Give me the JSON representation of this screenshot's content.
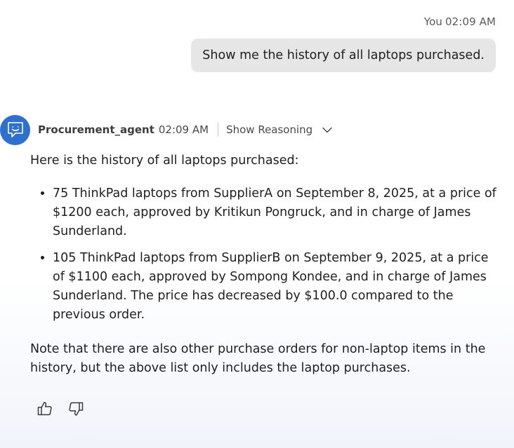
{
  "user_message": {
    "sender": "You",
    "time": "02:09 AM",
    "text": "Show me the history of all laptops purchased."
  },
  "agent_message": {
    "name": "Procurement_agent",
    "time": "02:09 AM",
    "reasoning_toggle_label": "Show Reasoning",
    "intro": "Here is the history of all laptops purchased:",
    "items": [
      "75 ThinkPad laptops from SupplierA on September 8, 2025, at a price of $1200 each, approved by Kritikun Pongruck, and in charge of James Sunderland.",
      "105 ThinkPad laptops from SupplierB on September 9, 2025, at a price of $1100 each, approved by Sompong Kondee, and in charge of James Sunderland. The price has decreased by $100.0 compared to the previous order."
    ],
    "note": "Note that there are also other purchase orders for non-laptop items in the history, but the above list only includes the laptop purchases."
  },
  "icons": {
    "avatar": "chatbot-icon",
    "reasoning_toggle": "chevron-down-icon",
    "feedback_positive": "thumbs-up-icon",
    "feedback_negative": "thumbs-down-icon"
  },
  "colors": {
    "avatar_bg": "#2f6fd0",
    "user_bubble_bg": "#e6e6e6"
  }
}
